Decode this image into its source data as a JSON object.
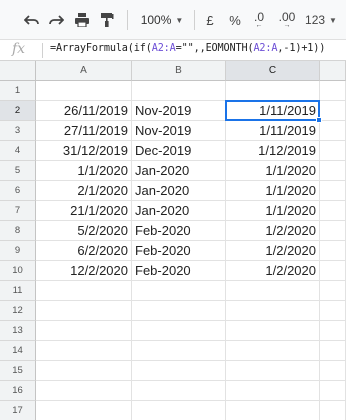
{
  "toolbar": {
    "zoom": "100%",
    "currency": "£",
    "percent": "%",
    "decrease_decimals": ".0",
    "increase_decimals": ".00",
    "more_formats": "123"
  },
  "formula_bar": {
    "fx": "fx",
    "parts": [
      "=ArrayFormula(if(",
      "A2:A",
      "=\"\",,EOMONTH(",
      "A2:A",
      ",-1)+1))"
    ]
  },
  "columns": [
    "A",
    "B",
    "C"
  ],
  "selected_cell": "C2",
  "rows": [
    {
      "num": "1",
      "a": "",
      "b": "",
      "c": ""
    },
    {
      "num": "2",
      "a": "26/11/2019",
      "b": "Nov-2019",
      "c": "1/11/2019"
    },
    {
      "num": "3",
      "a": "27/11/2019",
      "b": "Nov-2019",
      "c": "1/11/2019"
    },
    {
      "num": "4",
      "a": "31/12/2019",
      "b": "Dec-2019",
      "c": "1/12/2019"
    },
    {
      "num": "5",
      "a": "1/1/2020",
      "b": "Jan-2020",
      "c": "1/1/2020"
    },
    {
      "num": "6",
      "a": "2/1/2020",
      "b": "Jan-2020",
      "c": "1/1/2020"
    },
    {
      "num": "7",
      "a": "21/1/2020",
      "b": "Jan-2020",
      "c": "1/1/2020"
    },
    {
      "num": "8",
      "a": "5/2/2020",
      "b": "Feb-2020",
      "c": "1/2/2020"
    },
    {
      "num": "9",
      "a": "6/2/2020",
      "b": "Feb-2020",
      "c": "1/2/2020"
    },
    {
      "num": "10",
      "a": "12/2/2020",
      "b": "Feb-2020",
      "c": "1/2/2020"
    },
    {
      "num": "11",
      "a": "",
      "b": "",
      "c": ""
    },
    {
      "num": "12",
      "a": "",
      "b": "",
      "c": ""
    },
    {
      "num": "13",
      "a": "",
      "b": "",
      "c": ""
    },
    {
      "num": "14",
      "a": "",
      "b": "",
      "c": ""
    },
    {
      "num": "15",
      "a": "",
      "b": "",
      "c": ""
    },
    {
      "num": "16",
      "a": "",
      "b": "",
      "c": ""
    },
    {
      "num": "17",
      "a": "",
      "b": "",
      "c": ""
    }
  ]
}
